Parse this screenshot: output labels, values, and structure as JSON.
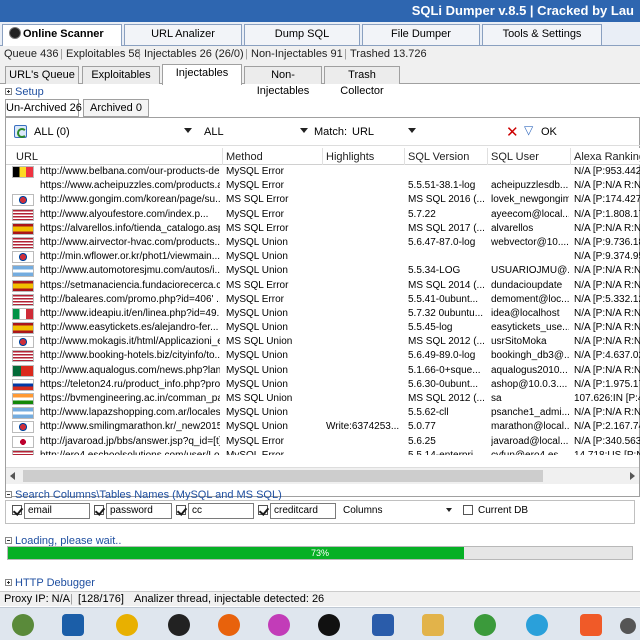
{
  "window": {
    "title": "SQLi Dumper v.8.5 | Cracked by Lau"
  },
  "top_tabs": [
    "Online Scanner",
    "URL Analizer",
    "Dump SQL",
    "File Dumper",
    "Tools & Settings"
  ],
  "stats": {
    "queue": "Queue 436",
    "exploitables": "Exploitables 58",
    "injectables": "Injectables 26 (26/0)",
    "non_injectables": "Non-Injectables 91",
    "trashed": "Trashed 13.726"
  },
  "sub_tabs": [
    "URL's Queue",
    "Exploitables",
    "Injectables",
    "Non-Injectables",
    "Trash Collector"
  ],
  "setup_label": "Setup",
  "archive_tabs": [
    "Un-Archived 26",
    "Archived 0"
  ],
  "filter": {
    "combo1": "ALL (0)",
    "combo2": "ALL",
    "match_label": "Match:",
    "match_value": "URL",
    "ok_label": "OK"
  },
  "table": {
    "headers": [
      "URL",
      "Method",
      "Highlights",
      "SQL Version",
      "SQL User",
      "Alexa Ranking"
    ],
    "rows": [
      {
        "flag": "be",
        "url": "http://www.belbana.com/our-products-de...",
        "method": "MySQL Error",
        "hl": "",
        "ver": "",
        "user": "",
        "alexa": "N/A [P:953.442"
      },
      {
        "flag": "",
        "url": "https://www.acheipuzzles.com/products.a...",
        "method": "MySQL Error",
        "hl": "",
        "ver": "5.5.51-38.1-log",
        "user": "acheipuzzlesdb...",
        "alexa": "N/A [P:N/A R:N/"
      },
      {
        "flag": "kr",
        "url": "http://www.gongim.com/korean/page/su...",
        "method": "MS SQL Error",
        "hl": "",
        "ver": "MS SQL 2016 (...",
        "user": "lovek_newgongim",
        "alexa": "N/A [P:174.427"
      },
      {
        "flag": "us",
        "url": "http://www.alyoufestore.com/index.p...",
        "method": "MySQL Error",
        "hl": "",
        "ver": "5.7.22",
        "user": "ayeecom@local...",
        "alexa": "N/A [P:1.808.17"
      },
      {
        "flag": "es",
        "url": "https://alvarellos.info/tienda_catalogo.asp...",
        "method": "MS SQL Error",
        "hl": "",
        "ver": "MS SQL 2017 (...",
        "user": "alvarellos",
        "alexa": "N/A [P:N/A R:N/"
      },
      {
        "flag": "us",
        "url": "http://www.airvector-hvac.com/products....",
        "method": "MySQL Union",
        "hl": "",
        "ver": "5.6.47-87.0-log",
        "user": "webvector@10....",
        "alexa": "N/A [P:9.736.18"
      },
      {
        "flag": "kr",
        "url": "http://min.wflower.or.kr/phot1/viewmain...",
        "method": "MySQL Union",
        "hl": "",
        "ver": "",
        "user": "",
        "alexa": "N/A [P:9.374.95"
      },
      {
        "flag": "ar",
        "url": "http://www.automotoresjmu.com/autos/i...",
        "method": "MySQL Union",
        "hl": "",
        "ver": "5.5.34-LOG",
        "user": "USUARIOJMU@...",
        "alexa": "N/A [P:N/A R:N/"
      },
      {
        "flag": "es",
        "url": "https://setmanaciencia.fundaciorecerca.c...",
        "method": "MS SQL Error",
        "hl": "",
        "ver": "MS SQL 2014 (...",
        "user": "dundacioupdate",
        "alexa": "N/A [P:N/A R:N/"
      },
      {
        "flag": "us",
        "url": "http://baleares.com/promo.php?id=406' ...",
        "method": "MySQL Error",
        "hl": "",
        "ver": "5.5.41-0ubunt...",
        "user": "demoment@loc...",
        "alexa": "N/A [P:5.332.12"
      },
      {
        "flag": "it",
        "url": "http://www.ideapiu.it/en/linea.php?id=49...",
        "method": "MySQL Union",
        "hl": "",
        "ver": "5.7.32 0ubuntu...",
        "user": "idea@localhost",
        "alexa": "N/A [P:N/A R:N/"
      },
      {
        "flag": "es",
        "url": "http://www.easytickets.es/alejandro-fer...",
        "method": "MySQL Union",
        "hl": "",
        "ver": "5.5.45-log",
        "user": "easytickets_use...",
        "alexa": "N/A [P:N/A R:N/"
      },
      {
        "flag": "kr",
        "url": "http://www.mokagis.it/html/Applicazioni_el...",
        "method": "MS SQL Union",
        "hl": "",
        "ver": "MS SQL 2012 (...",
        "user": "usrSitoMoka",
        "alexa": "N/A [P:N/A R:N/"
      },
      {
        "flag": "us",
        "url": "http://www.booking-hotels.biz/cityinfo/to...",
        "method": "MySQL Union",
        "hl": "",
        "ver": "5.6.49-89.0-log",
        "user": "bookingh_db3@...",
        "alexa": "N/A [P:4.637.02"
      },
      {
        "flag": "pt",
        "url": "http://www.aqualogus.com/news.php?lan...",
        "method": "MySQL Union",
        "hl": "",
        "ver": "5.1.66-0+sque...",
        "user": "aqualogus2010...",
        "alexa": "N/A [P:N/A R:N/"
      },
      {
        "flag": "ru",
        "url": "https://teleton24.ru/product_info.php?pro...",
        "method": "MySQL Union",
        "hl": "",
        "ver": "5.6.30-0ubunt...",
        "user": "ashop@10.0.3....",
        "alexa": "N/A [P:1.975.17"
      },
      {
        "flag": "in",
        "url": "https://bvmengineering.ac.in/comman_pa...",
        "method": "MS SQL Union",
        "hl": "",
        "ver": "MS SQL 2012 (...",
        "user": "sa",
        "alexa": "107.626:IN [P:4"
      },
      {
        "flag": "ar",
        "url": "http://www.lapazshopping.com.ar/locales-...",
        "method": "MySQL Union",
        "hl": "",
        "ver": "5.5.62-cll",
        "user": "psanche1_admi...",
        "alexa": "N/A [P:N/A R:N/"
      },
      {
        "flag": "kr",
        "url": "http://www.smilingmarathon.kr/_new2015...",
        "method": "MySQL Union",
        "hl": "Write:6374253...",
        "ver": "5.0.77",
        "user": "marathon@local...",
        "alexa": "N/A [P:2.167.74"
      },
      {
        "flag": "jp",
        "url": "http://javaroad.jp/bbs/answer.jsp?q_id=[t]",
        "method": "MySQL Error",
        "hl": "",
        "ver": "5.6.25",
        "user": "javaroad@local...",
        "alexa": "N/A [P:340.563"
      },
      {
        "flag": "us",
        "url": "http://ero4.eschoolsolutions.com/user/Lo...",
        "method": "MySQL Error",
        "hl": "",
        "ver": "5.5.14-enterpri...",
        "user": "cyfun@ero4.es...",
        "alexa": "14.718:US [P:N/"
      }
    ]
  },
  "search_section": {
    "label": "Search Columns\\Tables Names (MySQL and MS SQL)",
    "fields": [
      "email",
      "password",
      "cc",
      "creditcard"
    ],
    "columns_select": "Columns",
    "current_db": "Current DB"
  },
  "loading": {
    "label": "Loading, please wait..",
    "percent": 73,
    "percent_text": "73%"
  },
  "http_debugger": "HTTP Debugger",
  "status": {
    "proxy": "Proxy IP: N/A",
    "counter": "[128/176]",
    "message": "Analizer thread, injectable detected: 26"
  }
}
